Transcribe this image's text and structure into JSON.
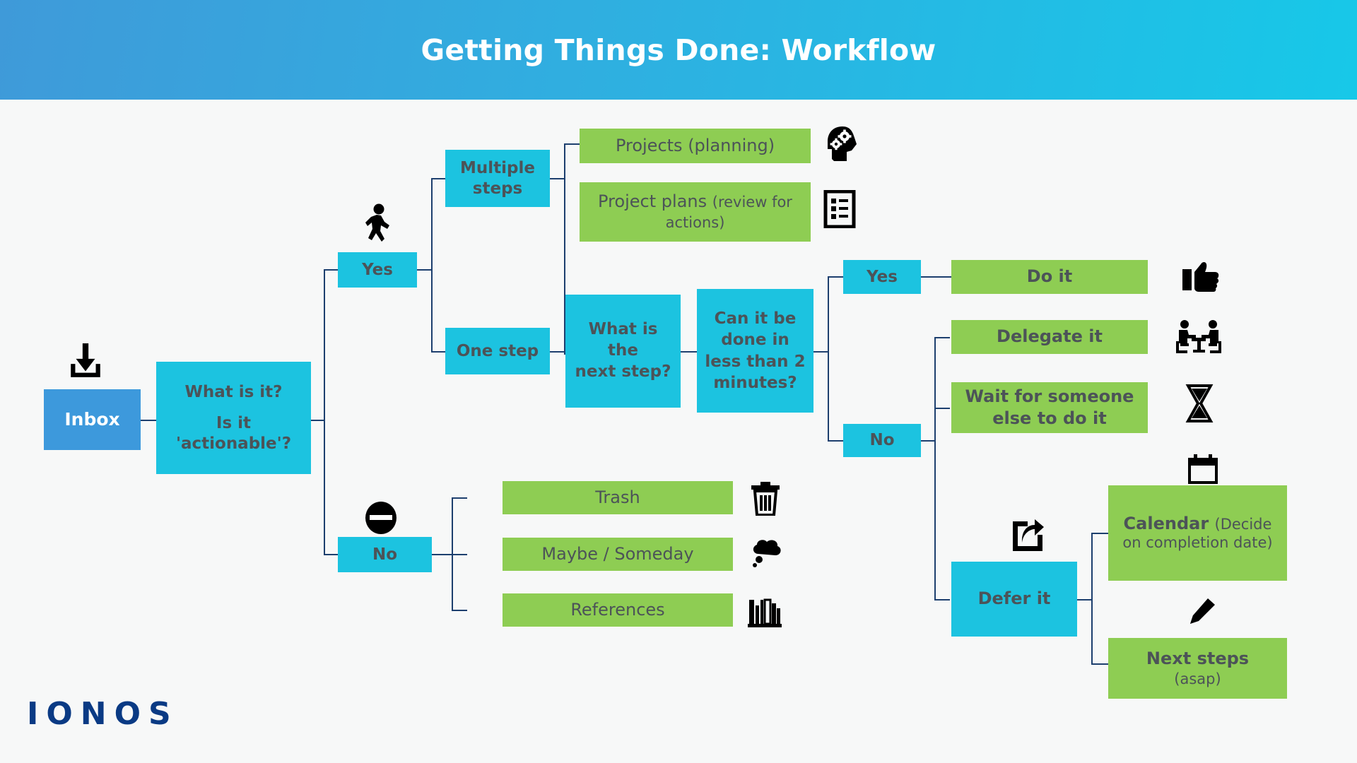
{
  "header": {
    "title": "Getting Things Done: Workflow",
    "gradient_from": "#3f9ad9",
    "gradient_to": "#17c8e8"
  },
  "colors": {
    "page_bg": "#f7f8f8",
    "cyan": "#1cc3e0",
    "blue": "#3d99dc",
    "green": "#8ecd53",
    "line": "#1d3f6e",
    "text_dark": "#4c5358",
    "logo": "#0a3a84"
  },
  "nodes": {
    "inbox": "Inbox",
    "what_is_it_line1": "What is it?",
    "what_is_it_line2": "Is it",
    "what_is_it_line3": "'actionable'?",
    "yes_top": "Yes",
    "no_bottom": "No",
    "multiple_steps_l1": "Multiple",
    "multiple_steps_l2": "steps",
    "one_step": "One step",
    "projects_main": "Projects ",
    "projects_sub": "(planning)",
    "project_plans_main": "Project plans ",
    "project_plans_sub": "(review for actions)",
    "next_step_l1": "What is the",
    "next_step_l2": "next step?",
    "two_min_l1": "Can it be",
    "two_min_l2": "done in",
    "two_min_l3": "less than 2",
    "two_min_l4": "minutes?",
    "yes_right": "Yes",
    "no_right": "No",
    "do_it": "Do it",
    "delegate_it": "Delegate it",
    "wait_l1": "Wait for someone",
    "wait_l2": "else to do it",
    "defer_it": "Defer it",
    "calendar_main": "Calendar ",
    "calendar_sub": "(Decide on completion date)",
    "next_steps_main": "Next steps",
    "next_steps_sub": "(asap)",
    "trash": "Trash",
    "maybe_someday": "Maybe / Someday",
    "references": "References"
  },
  "icons": {
    "inbox": "download-inbox-icon",
    "yes_branch": "walking-person-icon",
    "no_branch": "prohibited-circle-icon",
    "projects": "head-with-gears-icon",
    "project_plans": "checklist-document-icon",
    "do_it": "thumbs-up-icon",
    "delegate": "two-people-meeting-icon",
    "wait": "hourglass-icon",
    "calendar": "calendar-icon",
    "defer": "share-forward-icon",
    "next_steps": "pencil-icon",
    "trash": "trash-bin-icon",
    "maybe": "thought-cloud-icon",
    "references": "books-shelf-icon"
  },
  "footer": {
    "logo": "IONOS"
  }
}
